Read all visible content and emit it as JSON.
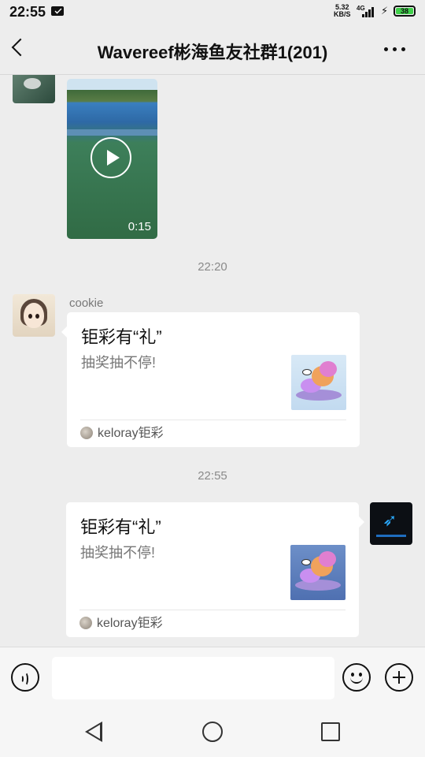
{
  "status_bar": {
    "time": "22:55",
    "net_speed_value": "5.32",
    "net_speed_unit": "KB/S",
    "network_type": "4G",
    "battery_level": "38",
    "icons": [
      "mail-icon",
      "signal-icon",
      "charging-icon",
      "battery-icon"
    ]
  },
  "header": {
    "title": "Wavereef彬海鱼友社群1(201)"
  },
  "messages": {
    "video": {
      "duration": "0:15"
    },
    "time_1": "22:20",
    "cookie_msg": {
      "sender": "cookie",
      "card_title": "钜彩有“礼”",
      "card_desc": "抽奖抽不停!",
      "source": "keloray钜彩"
    },
    "time_2": "22:55",
    "my_msg": {
      "card_title": "钜彩有“礼”",
      "card_desc": "抽奖抽不停!",
      "source": "keloray钜彩"
    }
  },
  "input_bar": {
    "placeholder": ""
  },
  "colors": {
    "background": "#ededed",
    "bubble": "#ffffff",
    "battery_green": "#3fd04a",
    "text_muted": "#777777"
  }
}
